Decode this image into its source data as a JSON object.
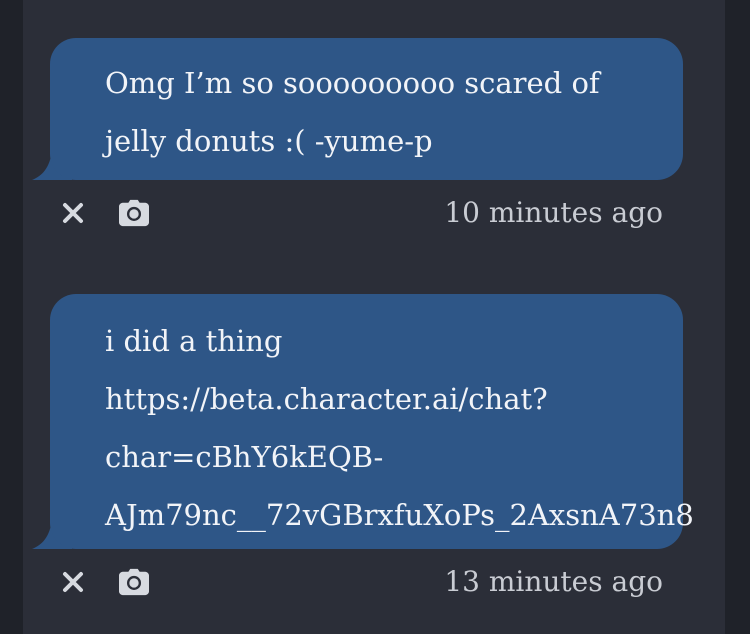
{
  "messages": [
    {
      "lines": [
        "Omg I’m so sooooooooo scared of",
        "jelly donuts :( -yume-p"
      ],
      "timestamp": "10 minutes ago",
      "actions": [
        "close-icon",
        "camera-icon"
      ]
    },
    {
      "lines": [
        "i did a thing",
        "https://beta.character.ai/chat?",
        "char=cBhY6kEQB-",
        "AJm79nc__72vGBrxfuXoPs_2AxsnA73n8"
      ],
      "timestamp": "13 minutes ago",
      "actions": [
        "close-icon",
        "camera-icon"
      ]
    }
  ],
  "colors": {
    "background": "#1f2229",
    "panel": "#2b2e38",
    "bubble": "#2e5687",
    "text": "#f2f4f8",
    "meta": "#c9ccd3"
  }
}
